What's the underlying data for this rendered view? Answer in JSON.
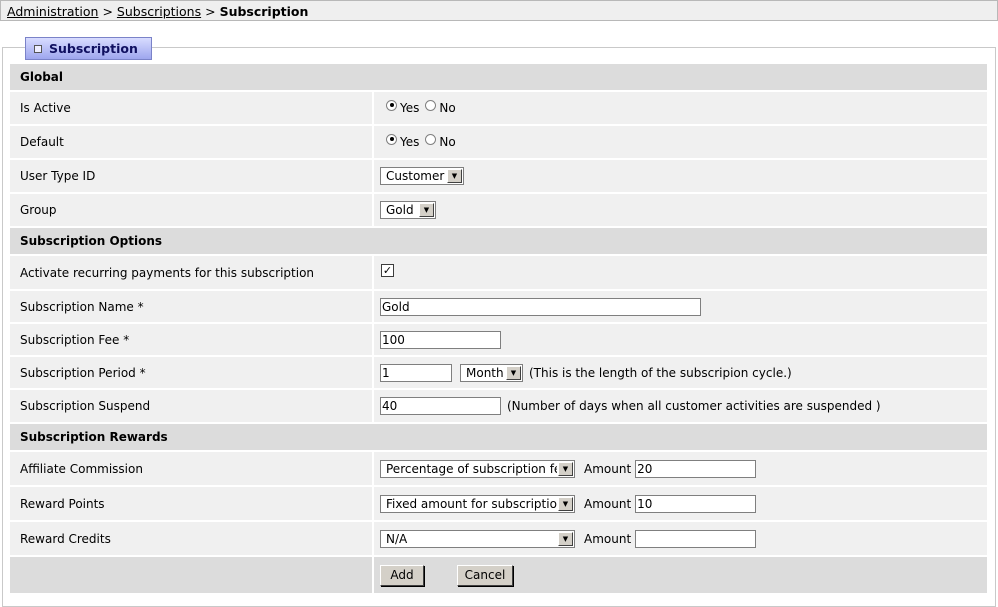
{
  "breadcrumb": {
    "items": [
      "Administration",
      "Subscriptions"
    ],
    "separator": ">",
    "current": "Subscription"
  },
  "tab_title": "Subscription",
  "sections": {
    "global": "Global",
    "options": "Subscription Options",
    "rewards": "Subscription Rewards"
  },
  "fields": {
    "is_active": {
      "label": "Is Active",
      "yes": "Yes",
      "no": "No",
      "value": "Yes"
    },
    "default": {
      "label": "Default",
      "yes": "Yes",
      "no": "No",
      "value": "Yes"
    },
    "user_type": {
      "label": "User Type ID",
      "value": "Customer"
    },
    "group": {
      "label": "Group",
      "value": "Gold"
    },
    "recurring": {
      "label": "Activate recurring payments for this subscription",
      "checked": true,
      "mark": "✓"
    },
    "name": {
      "label": "Subscription Name *",
      "value": "Gold"
    },
    "fee": {
      "label": "Subscription Fee *",
      "value": "100"
    },
    "period": {
      "label": "Subscription Period *",
      "value": "1",
      "unit": "Month",
      "note": "(This is the length of the subscripion cycle.)"
    },
    "suspend": {
      "label": "Subscription Suspend",
      "value": "40",
      "note": "(Number of days when all customer activities are suspended )"
    },
    "affiliate": {
      "label": "Affiliate Commission",
      "type": "Percentage of subscription fee",
      "amount_label": "Amount",
      "amount": "20"
    },
    "reward_points": {
      "label": "Reward Points",
      "type": "Fixed amount for subscription",
      "amount_label": "Amount",
      "amount": "10"
    },
    "reward_credits": {
      "label": "Reward Credits",
      "type": "N/A",
      "amount_label": "Amount",
      "amount": ""
    }
  },
  "buttons": {
    "add": "Add",
    "cancel": "Cancel"
  },
  "icons": {
    "dropdown": "chevron-down-icon",
    "tab_marker": "square-icon"
  }
}
